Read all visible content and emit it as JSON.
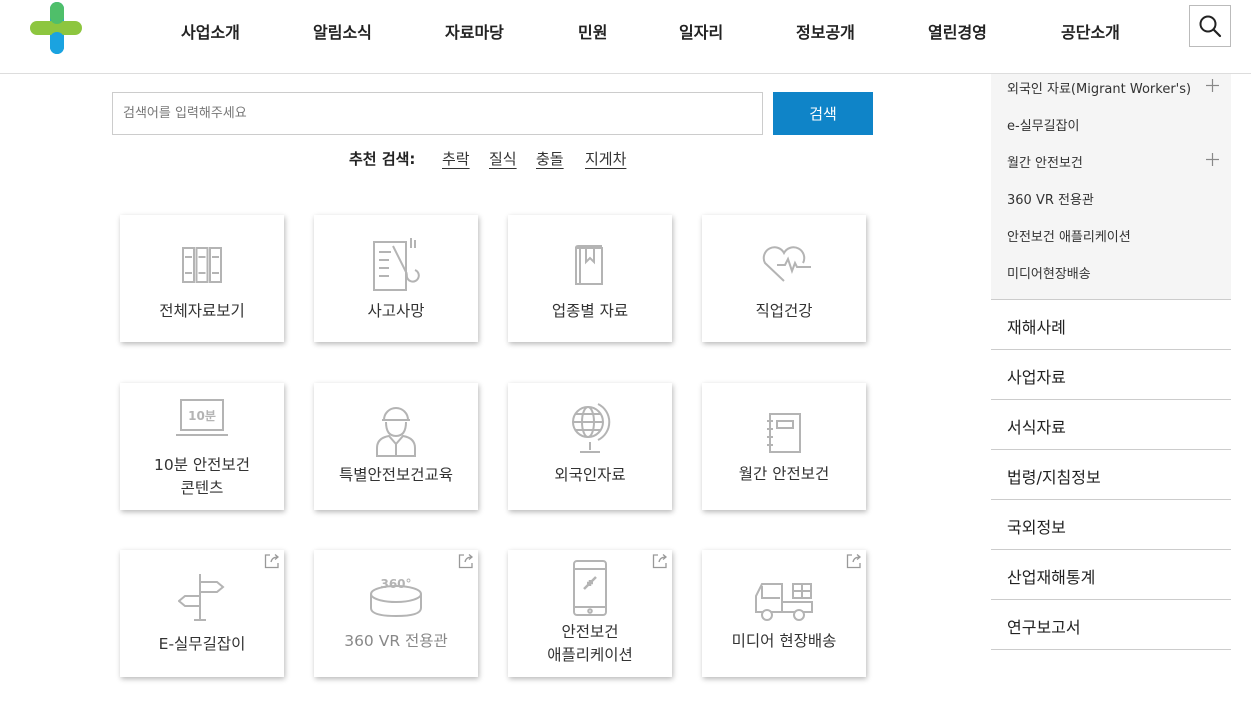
{
  "header": {
    "nav": [
      "사업소개",
      "알림소식",
      "자료마당",
      "민원",
      "일자리",
      "정보공개",
      "열린경영",
      "공단소개"
    ]
  },
  "search": {
    "placeholder": "검색어를 입력해주세요",
    "button": "검색",
    "recommend_label": "추천 검색:",
    "keywords": [
      "추락",
      "질식",
      "충돌",
      "지게차"
    ]
  },
  "cards": [
    {
      "label": "전체자료보기",
      "icon": "binders-icon"
    },
    {
      "label": "사고사망",
      "icon": "clipboard-wrench-icon"
    },
    {
      "label": "업종별 자료",
      "icon": "book-bookmark-icon"
    },
    {
      "label": "직업건강",
      "icon": "heartbeat-icon"
    },
    {
      "label_1": "10분 안전보건",
      "label_2": "콘텐츠",
      "icon": "laptop-10min-icon",
      "icon_text": "10분"
    },
    {
      "label": "특별안전보건교육",
      "icon": "worker-helmet-icon"
    },
    {
      "label": "외국인자료",
      "icon": "globe-icon"
    },
    {
      "label": "월간 안전보건",
      "icon": "notebook-icon"
    },
    {
      "label": "E-실무길잡이",
      "icon": "signpost-icon",
      "external": true
    },
    {
      "label": "360 VR 전용관",
      "icon": "vr-360-icon",
      "icon_text": "360°",
      "external": true
    },
    {
      "label_1": "안전보건",
      "label_2": "애플리케이션",
      "icon": "smartphone-icon",
      "external": true
    },
    {
      "label": "미디어 현장배송",
      "icon": "truck-icon",
      "external": true
    }
  ],
  "sidebar": {
    "sub_items": [
      {
        "label": "외국인 자료(Migrant Worker's)",
        "expandable": true
      },
      {
        "label": "e-실무길잡이",
        "expandable": false
      },
      {
        "label": "월간 안전보건",
        "expandable": true
      },
      {
        "label": "360 VR 전용관",
        "expandable": false
      },
      {
        "label": "안전보건 애플리케이션",
        "expandable": false
      },
      {
        "label": "미디어현장배송",
        "expandable": false
      }
    ],
    "items": [
      "재해사례",
      "사업자료",
      "서식자료",
      "법령/지침정보",
      "국외정보",
      "산업재해통계",
      "연구보고서"
    ]
  },
  "colors": {
    "accent": "#0f84c8",
    "logo_green": "#8dc63f",
    "logo_blue": "#1aa3e0",
    "icon_gray": "#b4b4b4"
  }
}
